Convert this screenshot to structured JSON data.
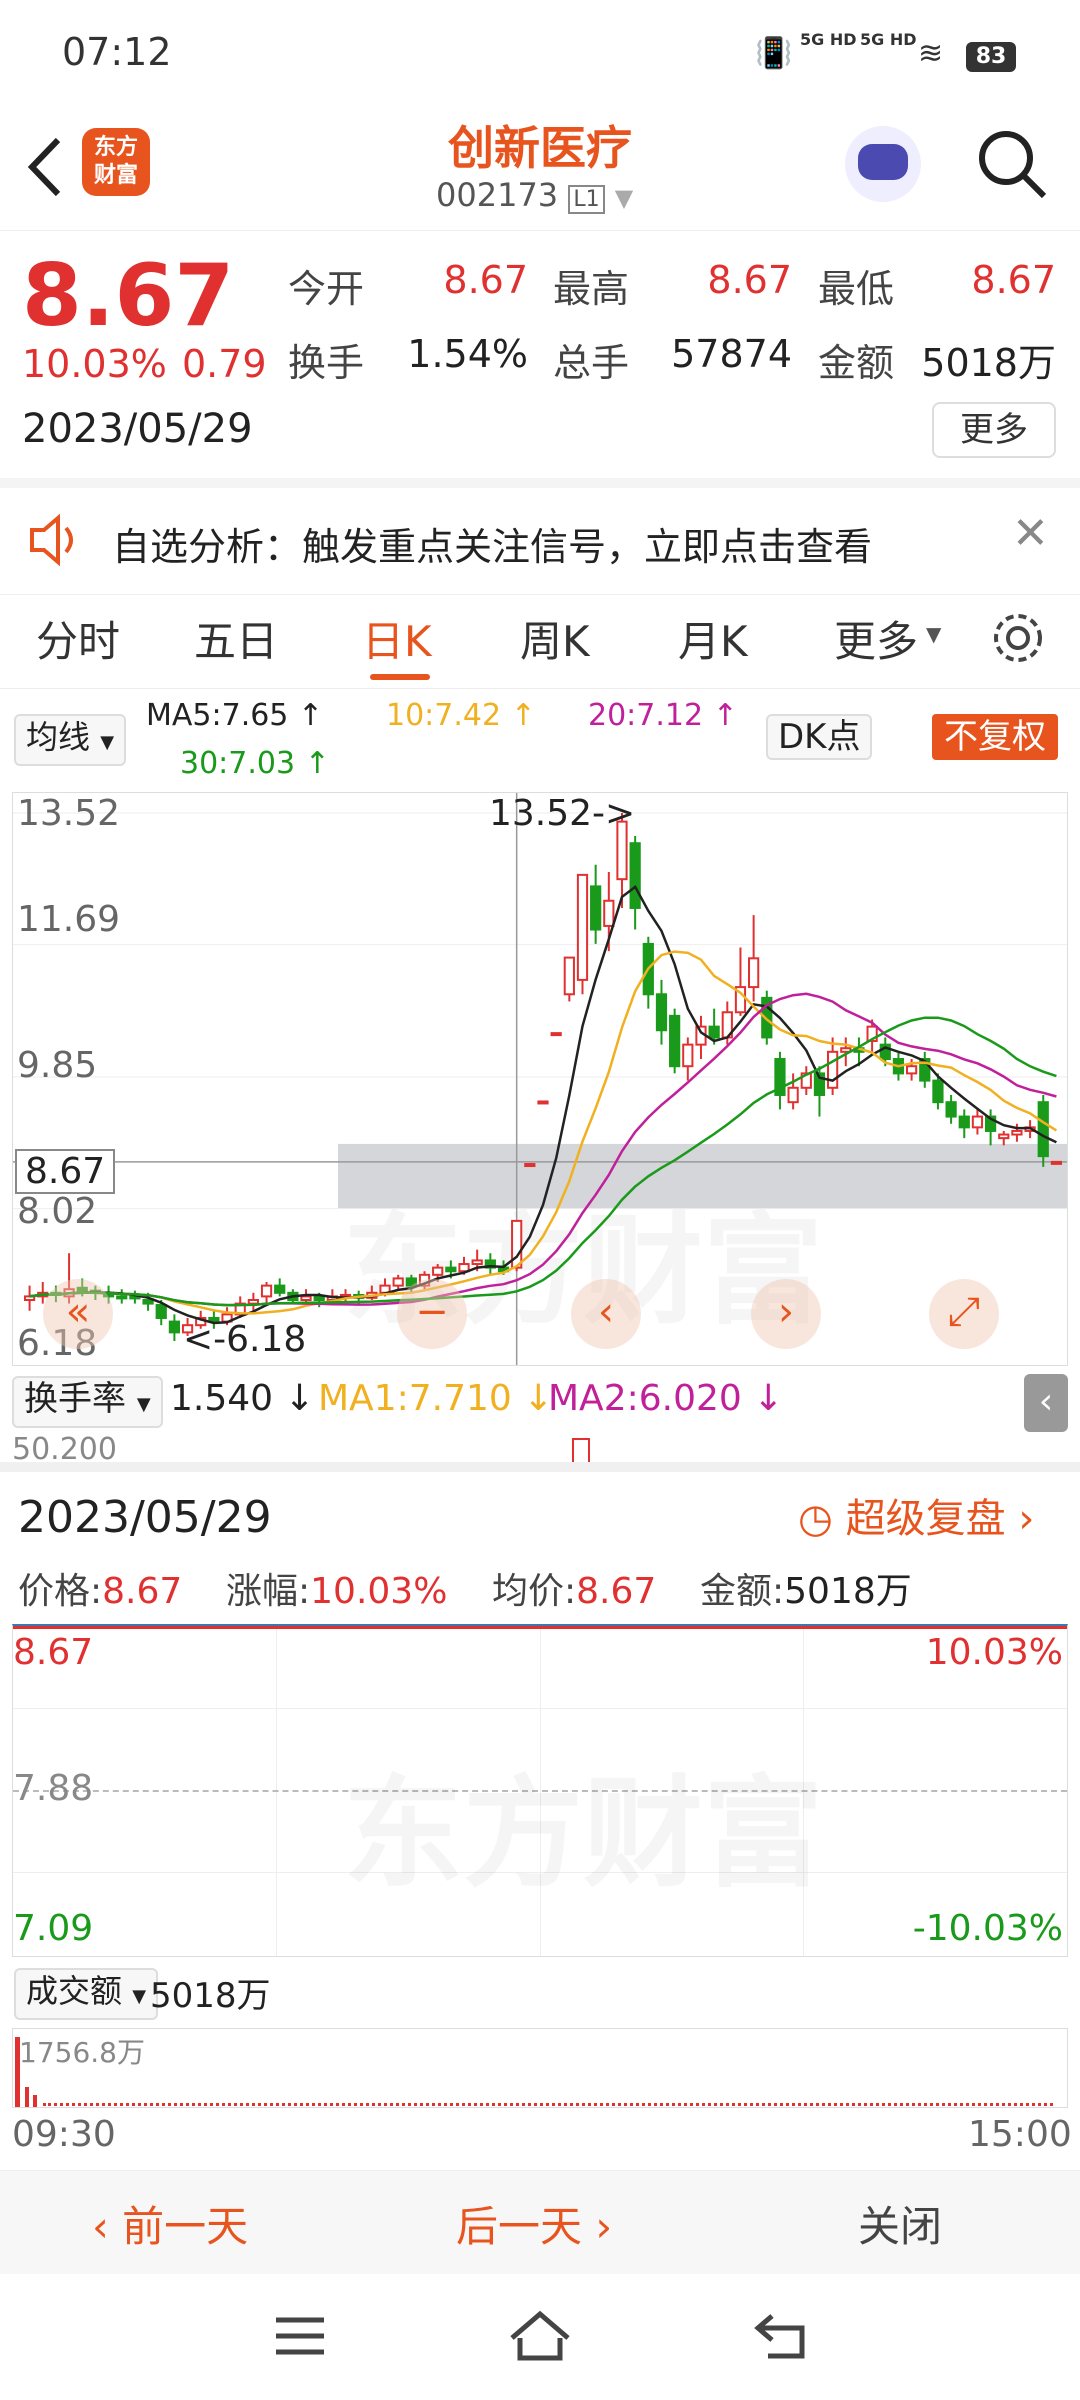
{
  "status_bar": {
    "time": "07:12",
    "signal1": "5G HD",
    "signal2": "5G HD",
    "battery": "83"
  },
  "header": {
    "badge_line1": "东方",
    "badge_line2": "财富",
    "title": "创新医疗",
    "code": "002173",
    "level": "L1"
  },
  "quote": {
    "price": "8.67",
    "change_pct": "10.03%",
    "change": "0.79",
    "date": "2023/05/29",
    "open_label": "今开",
    "open": "8.67",
    "high_label": "最高",
    "high": "8.67",
    "low_label": "最低",
    "low": "8.67",
    "turnover_label": "换手",
    "turnover": "1.54%",
    "volume_label": "总手",
    "volume": "57874",
    "amount_label": "金额",
    "amount": "5018万",
    "more_label": "更多"
  },
  "notice": {
    "text": "自选分析：触发重点关注信号，立即点击查看"
  },
  "tabs": [
    {
      "label": "分时"
    },
    {
      "label": "五日"
    },
    {
      "label": "日K"
    },
    {
      "label": "周K"
    },
    {
      "label": "月K"
    },
    {
      "label": "更多"
    }
  ],
  "ma_bar": {
    "selector": "均线",
    "ma5": "MA5:7.65 ↑",
    "ma10": "10:7.42 ↑",
    "ma20": "20:7.12 ↑",
    "ma30": "30:7.03 ↑",
    "dk": "DK点",
    "fq": "不复权"
  },
  "kline_axis": {
    "y1": "13.52",
    "y2": "11.69",
    "y3": "9.85",
    "y4": "8.02",
    "y5": "6.18",
    "cursor_price": "8.67",
    "high_marker": "13.52->",
    "low_marker": "<-6.18"
  },
  "indicator": {
    "selector": "换手率",
    "value": "1.540 ↓",
    "ma1": "MA1:7.710 ↓",
    "ma2": "MA2:6.020 ↓",
    "partial": "50.200"
  },
  "detail": {
    "date": "2023/05/29",
    "review": "超级复盘",
    "price_label": "价格:",
    "price": "8.67",
    "chg_label": "涨幅:",
    "chg": "10.03%",
    "avg_label": "均价:",
    "avg": "8.67",
    "amt_label": "金额:",
    "amt": "5018万",
    "top_left": "8.67",
    "top_right": "10.03%",
    "mid": "7.88",
    "bot_left": "7.09",
    "bot_right": "-10.03%",
    "vol_selector": "成交额",
    "vol_value": "5018万",
    "vol_max": "1756.8万",
    "t_start": "09:30",
    "t_end": "15:00"
  },
  "footer": {
    "prev": "前一天",
    "next": "后一天",
    "close": "关闭"
  },
  "colors": {
    "accent": "#e8541e",
    "up": "#e03030",
    "down": "#1a9a1a",
    "ma5": "#222222",
    "ma10": "#f0b020",
    "ma20": "#c0209a",
    "ma30": "#1a9a1a"
  },
  "chart_data": {
    "type": "candlestick",
    "ylim": [
      6.18,
      13.52
    ],
    "candles": [
      {
        "o": 6.75,
        "c": 6.8,
        "h": 6.95,
        "l": 6.6
      },
      {
        "o": 6.8,
        "c": 6.85,
        "h": 7.0,
        "l": 6.7
      },
      {
        "o": 6.85,
        "c": 6.82,
        "h": 6.95,
        "l": 6.72
      },
      {
        "o": 6.8,
        "c": 6.9,
        "h": 7.4,
        "l": 6.7
      },
      {
        "o": 6.92,
        "c": 6.88,
        "h": 7.05,
        "l": 6.8
      },
      {
        "o": 6.88,
        "c": 6.85,
        "h": 6.95,
        "l": 6.75
      },
      {
        "o": 6.85,
        "c": 6.8,
        "h": 6.95,
        "l": 6.7
      },
      {
        "o": 6.8,
        "c": 6.78,
        "h": 6.9,
        "l": 6.7
      },
      {
        "o": 6.8,
        "c": 6.78,
        "h": 6.88,
        "l": 6.7
      },
      {
        "o": 6.75,
        "c": 6.7,
        "h": 6.85,
        "l": 6.6
      },
      {
        "o": 6.68,
        "c": 6.5,
        "h": 6.75,
        "l": 6.4
      },
      {
        "o": 6.45,
        "c": 6.3,
        "h": 6.55,
        "l": 6.18
      },
      {
        "o": 6.3,
        "c": 6.4,
        "h": 6.5,
        "l": 6.25
      },
      {
        "o": 6.4,
        "c": 6.5,
        "h": 6.6,
        "l": 6.35
      },
      {
        "o": 6.5,
        "c": 6.45,
        "h": 6.6,
        "l": 6.35
      },
      {
        "o": 6.45,
        "c": 6.55,
        "h": 6.65,
        "l": 6.4
      },
      {
        "o": 6.55,
        "c": 6.7,
        "h": 6.8,
        "l": 6.5
      },
      {
        "o": 6.7,
        "c": 6.75,
        "h": 6.85,
        "l": 6.6
      },
      {
        "o": 6.8,
        "c": 6.95,
        "h": 7.0,
        "l": 6.7
      },
      {
        "o": 6.95,
        "c": 6.85,
        "h": 7.05,
        "l": 6.8
      },
      {
        "o": 6.85,
        "c": 6.75,
        "h": 6.9,
        "l": 6.7
      },
      {
        "o": 6.75,
        "c": 6.8,
        "h": 6.9,
        "l": 6.7
      },
      {
        "o": 6.8,
        "c": 6.75,
        "h": 6.85,
        "l": 6.65
      },
      {
        "o": 6.75,
        "c": 6.8,
        "h": 6.9,
        "l": 6.7
      },
      {
        "o": 6.8,
        "c": 6.82,
        "h": 6.9,
        "l": 6.72
      },
      {
        "o": 6.82,
        "c": 6.78,
        "h": 6.88,
        "l": 6.7
      },
      {
        "o": 6.78,
        "c": 6.85,
        "h": 6.95,
        "l": 6.75
      },
      {
        "o": 6.85,
        "c": 6.95,
        "h": 7.05,
        "l": 6.8
      },
      {
        "o": 6.95,
        "c": 7.05,
        "h": 7.1,
        "l": 6.9
      },
      {
        "o": 7.05,
        "c": 6.95,
        "h": 7.1,
        "l": 6.85
      },
      {
        "o": 6.95,
        "c": 7.1,
        "h": 7.15,
        "l": 6.9
      },
      {
        "o": 7.1,
        "c": 7.2,
        "h": 7.25,
        "l": 7.0
      },
      {
        "o": 7.2,
        "c": 7.15,
        "h": 7.3,
        "l": 7.05
      },
      {
        "o": 7.15,
        "c": 7.25,
        "h": 7.35,
        "l": 7.1
      },
      {
        "o": 7.25,
        "c": 7.3,
        "h": 7.45,
        "l": 7.15
      },
      {
        "o": 7.3,
        "c": 7.2,
        "h": 7.4,
        "l": 7.1
      },
      {
        "o": 7.2,
        "c": 7.15,
        "h": 7.3,
        "l": 7.1
      },
      {
        "o": 7.2,
        "c": 7.85,
        "h": 7.85,
        "l": 7.15
      },
      {
        "o": 8.64,
        "c": 8.64,
        "h": 8.64,
        "l": 8.64
      },
      {
        "o": 9.51,
        "c": 9.51,
        "h": 9.51,
        "l": 9.51
      },
      {
        "o": 10.46,
        "c": 10.46,
        "h": 10.46,
        "l": 10.46
      },
      {
        "o": 11.0,
        "c": 11.51,
        "h": 11.51,
        "l": 10.9
      },
      {
        "o": 11.2,
        "c": 12.66,
        "h": 12.66,
        "l": 11.0
      },
      {
        "o": 12.5,
        "c": 11.9,
        "h": 12.8,
        "l": 11.7
      },
      {
        "o": 11.95,
        "c": 12.3,
        "h": 12.7,
        "l": 11.6
      },
      {
        "o": 12.6,
        "c": 13.4,
        "h": 13.52,
        "l": 12.2
      },
      {
        "o": 13.1,
        "c": 12.2,
        "h": 13.2,
        "l": 11.9
      },
      {
        "o": 11.7,
        "c": 11.0,
        "h": 11.8,
        "l": 10.8
      },
      {
        "o": 11.0,
        "c": 10.5,
        "h": 11.2,
        "l": 10.3
      },
      {
        "o": 10.7,
        "c": 10.0,
        "h": 10.8,
        "l": 9.9
      },
      {
        "o": 10.0,
        "c": 10.3,
        "h": 10.4,
        "l": 9.8
      },
      {
        "o": 10.3,
        "c": 10.55,
        "h": 10.7,
        "l": 10.1
      },
      {
        "o": 10.55,
        "c": 10.4,
        "h": 10.8,
        "l": 10.3
      },
      {
        "o": 10.4,
        "c": 10.75,
        "h": 10.9,
        "l": 10.3
      },
      {
        "o": 10.75,
        "c": 11.1,
        "h": 11.65,
        "l": 10.7
      },
      {
        "o": 11.1,
        "c": 11.5,
        "h": 12.1,
        "l": 10.9
      },
      {
        "o": 10.95,
        "c": 10.4,
        "h": 11.05,
        "l": 10.3
      },
      {
        "o": 10.1,
        "c": 9.6,
        "h": 10.2,
        "l": 9.4
      },
      {
        "o": 9.5,
        "c": 9.7,
        "h": 9.9,
        "l": 9.4
      },
      {
        "o": 9.7,
        "c": 9.9,
        "h": 10.0,
        "l": 9.6
      },
      {
        "o": 9.9,
        "c": 9.6,
        "h": 10.0,
        "l": 9.3
      },
      {
        "o": 9.7,
        "c": 10.2,
        "h": 10.4,
        "l": 9.6
      },
      {
        "o": 10.2,
        "c": 10.25,
        "h": 10.4,
        "l": 10.0
      },
      {
        "o": 10.25,
        "c": 10.2,
        "h": 10.4,
        "l": 10.0
      },
      {
        "o": 10.35,
        "c": 10.55,
        "h": 10.65,
        "l": 10.2
      },
      {
        "o": 10.3,
        "c": 10.1,
        "h": 10.4,
        "l": 10.0
      },
      {
        "o": 10.1,
        "c": 9.9,
        "h": 10.2,
        "l": 9.8
      },
      {
        "o": 9.9,
        "c": 10.0,
        "h": 10.1,
        "l": 9.8
      },
      {
        "o": 10.1,
        "c": 9.8,
        "h": 10.2,
        "l": 9.7
      },
      {
        "o": 9.8,
        "c": 9.5,
        "h": 9.9,
        "l": 9.4
      },
      {
        "o": 9.5,
        "c": 9.3,
        "h": 9.6,
        "l": 9.2
      },
      {
        "o": 9.3,
        "c": 9.15,
        "h": 9.4,
        "l": 9.0
      },
      {
        "o": 9.15,
        "c": 9.3,
        "h": 9.4,
        "l": 9.05
      },
      {
        "o": 9.3,
        "c": 9.1,
        "h": 9.4,
        "l": 8.9
      },
      {
        "o": 9.0,
        "c": 9.05,
        "h": 9.1,
        "l": 8.9
      },
      {
        "o": 9.05,
        "c": 9.1,
        "h": 9.2,
        "l": 8.95
      },
      {
        "o": 9.1,
        "c": 9.15,
        "h": 9.25,
        "l": 9.0
      },
      {
        "o": 9.5,
        "c": 8.75,
        "h": 9.6,
        "l": 8.6
      },
      {
        "o": 8.67,
        "c": 8.67,
        "h": 8.67,
        "l": 8.67
      }
    ]
  }
}
